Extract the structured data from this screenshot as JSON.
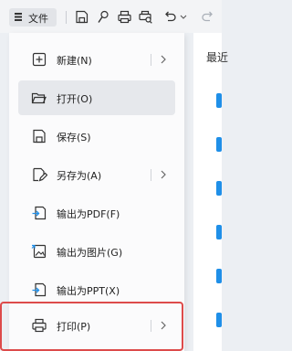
{
  "toolbar": {
    "file_label": "文件",
    "icons": [
      "save-icon",
      "brush-icon",
      "print-icon",
      "print-preview-icon",
      "undo-icon",
      "redo-icon"
    ]
  },
  "right_panel": {
    "title": "最近"
  },
  "menu": {
    "items": [
      {
        "label": "新建(N)",
        "icon": "new-file-icon",
        "submenu": true
      },
      {
        "label": "打开(O)",
        "icon": "folder-open-icon",
        "submenu": false
      },
      {
        "label": "保存(S)",
        "icon": "save-icon",
        "submenu": false
      },
      {
        "label": "另存为(A)",
        "icon": "save-as-icon",
        "submenu": true
      },
      {
        "label": "输出为PDF(F)",
        "icon": "export-pdf-icon",
        "submenu": false
      },
      {
        "label": "输出为图片(G)",
        "icon": "export-image-icon",
        "submenu": false
      },
      {
        "label": "输出为PPT(X)",
        "icon": "export-ppt-icon",
        "submenu": false
      },
      {
        "label": "打印(P)",
        "icon": "print-icon",
        "submenu": true
      }
    ]
  },
  "colors": {
    "accent": "#1f8fe8",
    "highlight_border": "#dd4b4b",
    "hover_bg": "#e6e8ec"
  }
}
